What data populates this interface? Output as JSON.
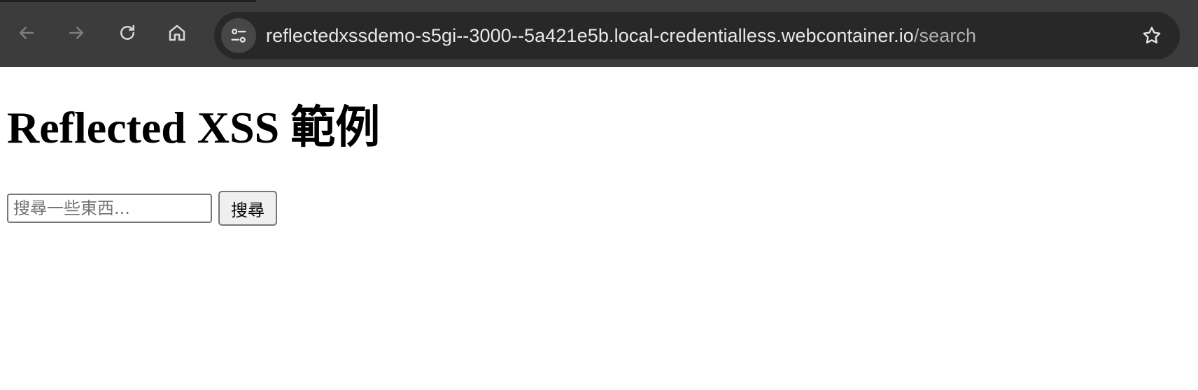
{
  "browser": {
    "url_host": "reflectedxssdemo-s5gi--3000--5a421e5b.local-credentialless.webcontainer.io",
    "url_path": "/search",
    "icons": {
      "back": "back-arrow-icon",
      "forward": "forward-arrow-icon",
      "reload": "reload-icon",
      "home": "home-icon",
      "site_info": "tune-icon",
      "bookmark": "star-icon"
    },
    "colors": {
      "toolbar": "#3c3c3c",
      "omnibox": "#282828",
      "url_text": "#e8e8e8"
    }
  },
  "page": {
    "heading": "Reflected XSS 範例",
    "search": {
      "value": "",
      "placeholder": "搜尋一些東西...",
      "button_label": "搜尋"
    }
  }
}
